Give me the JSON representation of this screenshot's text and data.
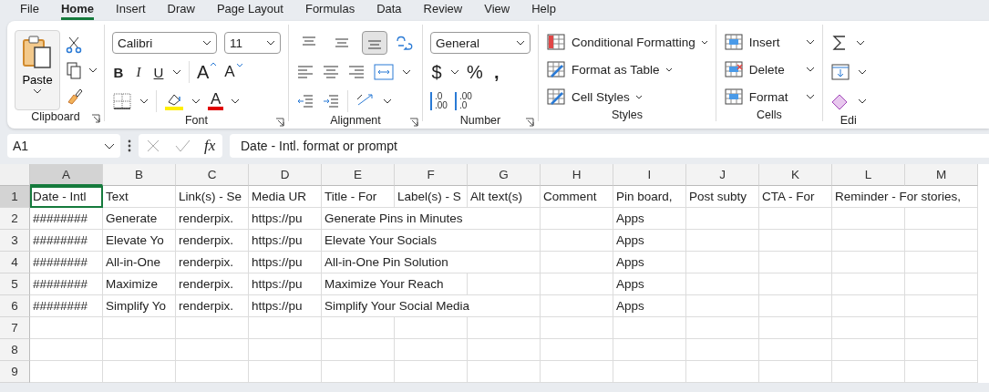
{
  "tabs": [
    {
      "label": "File",
      "selected": false
    },
    {
      "label": "Home",
      "selected": true
    },
    {
      "label": "Insert",
      "selected": false
    },
    {
      "label": "Draw",
      "selected": false
    },
    {
      "label": "Page Layout",
      "selected": false
    },
    {
      "label": "Formulas",
      "selected": false
    },
    {
      "label": "Data",
      "selected": false
    },
    {
      "label": "Review",
      "selected": false
    },
    {
      "label": "View",
      "selected": false
    },
    {
      "label": "Help",
      "selected": false
    }
  ],
  "ribbon": {
    "clipboard": {
      "label": "Clipboard",
      "paste": "Paste"
    },
    "font": {
      "label": "Font",
      "family": "Calibri",
      "size": "11",
      "bold": "B",
      "italic": "I",
      "underline": "U",
      "grow": "A",
      "shrink": "A",
      "font_color": "A"
    },
    "alignment": {
      "label": "Alignment",
      "vertical": [
        {
          "selected": false
        },
        {
          "selected": false
        },
        {
          "selected": true
        }
      ]
    },
    "number": {
      "label": "Number",
      "format": "General",
      "currency": "$",
      "percent": "%",
      "comma": ",",
      "decimals": [
        {
          "top": ".0",
          "bottom": ".00"
        },
        {
          "top": ".00",
          "bottom": ".0"
        }
      ]
    },
    "styles": {
      "label": "Styles",
      "buttons": [
        "Conditional Formatting",
        "Format as Table",
        "Cell Styles"
      ]
    },
    "cells": {
      "label": "Cells",
      "buttons": [
        "Insert",
        "Delete",
        "Format"
      ]
    },
    "editing": {
      "label": "Edi"
    }
  },
  "formula_bar": {
    "name_box": "A1",
    "function_label": "fx",
    "value": "Date - Intl. format or prompt"
  },
  "sheet": {
    "columns": [
      {
        "label": "A",
        "selected": true
      },
      {
        "label": "B",
        "selected": false
      },
      {
        "label": "C",
        "selected": false
      },
      {
        "label": "D",
        "selected": false
      },
      {
        "label": "E",
        "selected": false
      },
      {
        "label": "F",
        "selected": false
      },
      {
        "label": "G",
        "selected": false
      },
      {
        "label": "H",
        "selected": false
      },
      {
        "label": "I",
        "selected": false
      },
      {
        "label": "J",
        "selected": false
      },
      {
        "label": "K",
        "selected": false
      },
      {
        "label": "L",
        "selected": false
      },
      {
        "label": "M",
        "selected": false
      }
    ],
    "rows": [
      {
        "number": "1",
        "selected": true,
        "cells": [
          "Date - Intl",
          "Text",
          "Link(s) - Se",
          "Media UR",
          "Title - For",
          "Label(s) - S",
          "Alt text(s)",
          "Comment",
          "Pin board,",
          "Post subty",
          "CTA - For",
          "Reminder - For stories,"
        ]
      },
      {
        "number": "2",
        "selected": false,
        "cells": [
          "########",
          "Generate",
          "renderpix.",
          "https://pu",
          "Generate Pins in Minutes",
          null,
          null,
          null,
          "Apps"
        ]
      },
      {
        "number": "3",
        "selected": false,
        "cells": [
          "########",
          "Elevate Yo",
          "renderpix.",
          "https://pu",
          "Elevate Your Socials",
          null,
          null,
          null,
          "Apps"
        ]
      },
      {
        "number": "4",
        "selected": false,
        "cells": [
          "########",
          "All-in-One",
          "renderpix.",
          "https://pu",
          "All-in-One Pin Solution",
          null,
          null,
          null,
          "Apps"
        ]
      },
      {
        "number": "5",
        "selected": false,
        "cells": [
          "########",
          "Maximize",
          "renderpix.",
          "https://pu",
          "Maximize Your Reach",
          null,
          null,
          null,
          "Apps"
        ]
      },
      {
        "number": "6",
        "selected": false,
        "cells": [
          "########",
          "Simplify Yo",
          "renderpix.",
          "https://pu",
          "Simplify Your Social Media",
          null,
          null,
          null,
          "Apps"
        ]
      },
      {
        "number": "7",
        "selected": false
      },
      {
        "number": "8",
        "selected": false
      },
      {
        "number": "9",
        "selected": false
      }
    ]
  }
}
